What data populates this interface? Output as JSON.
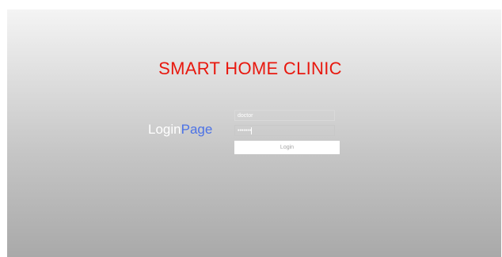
{
  "header": {
    "title": "SMART HOME CLINIC"
  },
  "login": {
    "label_part1": "Login",
    "label_part2": "Page",
    "username_value": "doctor",
    "password_value": "•••••••",
    "button_label": "Login"
  },
  "colors": {
    "title": "#e8180e",
    "label_login": "#ffffff",
    "label_page": "#4c72e6"
  }
}
